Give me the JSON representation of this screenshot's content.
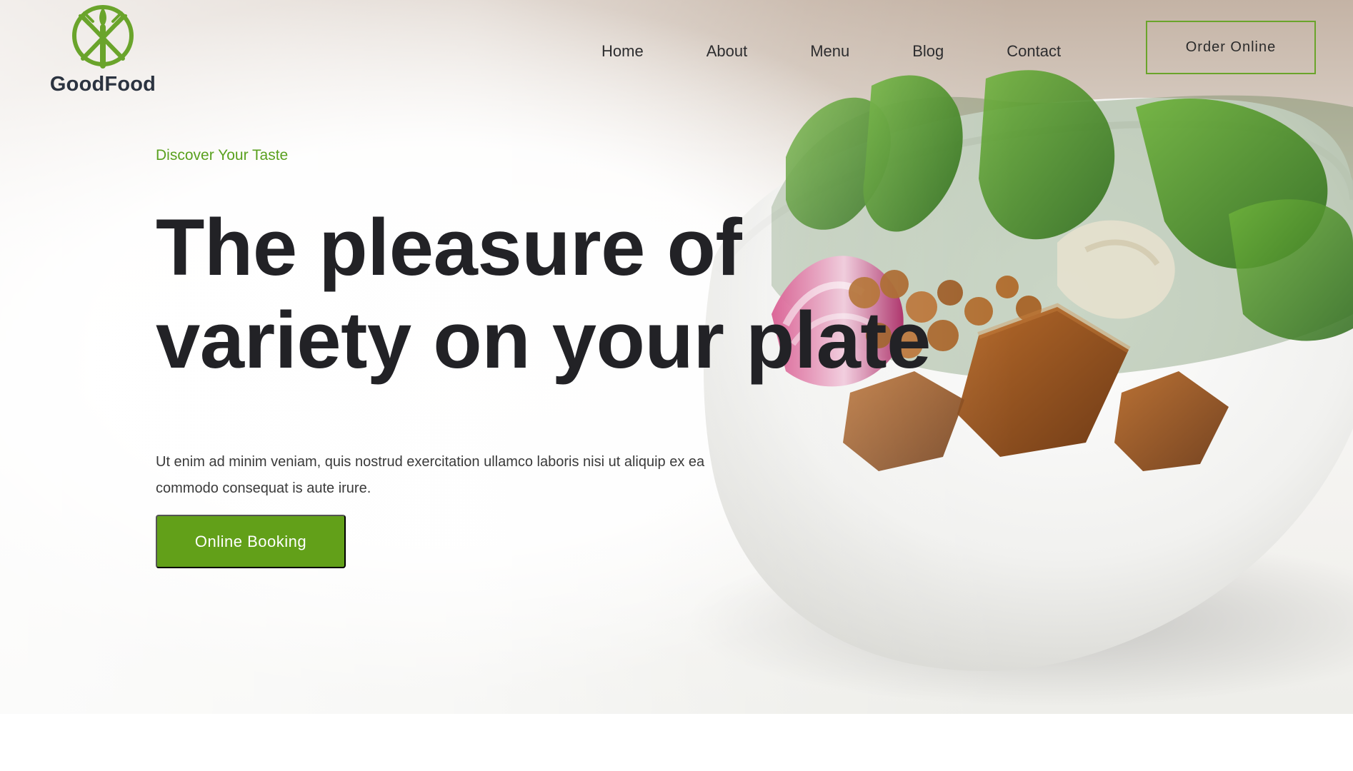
{
  "brand": {
    "name": "GoodFood",
    "accent": "#6aa42b",
    "dark": "#2b3340"
  },
  "nav": {
    "items": [
      {
        "label": "Home"
      },
      {
        "label": "About"
      },
      {
        "label": "Menu"
      },
      {
        "label": "Blog"
      },
      {
        "label": "Contact"
      }
    ],
    "cta_label": "Order Online"
  },
  "hero": {
    "eyebrow": "Discover Your Taste",
    "headline": {
      "line1": "The pleasure of",
      "line2": "variety on your plate"
    },
    "body": "Ut enim ad minim veniam, quis nostrud exercitation ullamco laboris nisi ut aliquip ex ea commodo consequat is aute irure.",
    "cta_label": "Online Booking",
    "image_alt_icon": "salad-bowl-icon"
  },
  "colors": {
    "heading": "#222226",
    "text": "#3a3a3a",
    "button_green": "#62a019"
  }
}
